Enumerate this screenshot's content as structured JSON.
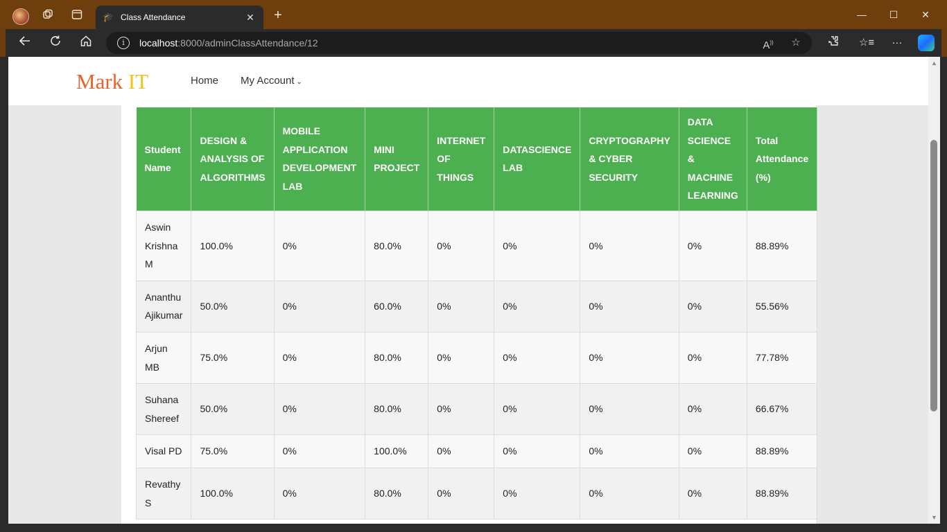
{
  "browser": {
    "tab_title": "Class Attendance",
    "url_host": "localhost",
    "url_path": ":8000/adminClassAttendance/12"
  },
  "site": {
    "brand_part1": "Mark",
    "brand_part2": "IT",
    "nav": {
      "home": "Home",
      "account": "My Account"
    }
  },
  "table": {
    "headers": [
      [
        "Student",
        "Name"
      ],
      [
        "DESIGN &",
        "ANALYSIS OF",
        "ALGORITHMS"
      ],
      [
        "MOBILE",
        "APPLICATION",
        "DEVELOPMENT",
        "LAB"
      ],
      [
        "MINI",
        "PROJECT"
      ],
      [
        "INTERNET",
        "OF",
        "THINGS"
      ],
      [
        "DATASCIENCE",
        "LAB"
      ],
      [
        "CRYPTOGRAPHY",
        "& CYBER",
        "SECURITY"
      ],
      [
        "DATA",
        "SCIENCE",
        "&",
        "MACHINE",
        "LEARNING"
      ],
      [
        "Total",
        "Attendance",
        "(%)"
      ]
    ],
    "rows": [
      {
        "name": [
          "Aswin",
          "Krishna",
          "M"
        ],
        "values": [
          "100.0%",
          "0%",
          "80.0%",
          "0%",
          "0%",
          "0%",
          "0%",
          "88.89%"
        ]
      },
      {
        "name": [
          "Ananthu",
          "Ajikumar"
        ],
        "values": [
          "50.0%",
          "0%",
          "60.0%",
          "0%",
          "0%",
          "0%",
          "0%",
          "55.56%"
        ]
      },
      {
        "name": [
          "Arjun",
          "MB"
        ],
        "values": [
          "75.0%",
          "0%",
          "80.0%",
          "0%",
          "0%",
          "0%",
          "0%",
          "77.78%"
        ]
      },
      {
        "name": [
          "Suhana",
          "Shereef"
        ],
        "values": [
          "50.0%",
          "0%",
          "80.0%",
          "0%",
          "0%",
          "0%",
          "0%",
          "66.67%"
        ]
      },
      {
        "name": [
          "Visal PD"
        ],
        "values": [
          "75.0%",
          "0%",
          "100.0%",
          "0%",
          "0%",
          "0%",
          "0%",
          "88.89%"
        ]
      },
      {
        "name": [
          "Revathy",
          "S"
        ],
        "values": [
          "100.0%",
          "0%",
          "80.0%",
          "0%",
          "0%",
          "0%",
          "0%",
          "88.89%"
        ]
      }
    ]
  },
  "colors": {
    "header_green": "#4caf50",
    "brand_orange": "#e8622a",
    "brand_yellow": "#f2c01a"
  }
}
